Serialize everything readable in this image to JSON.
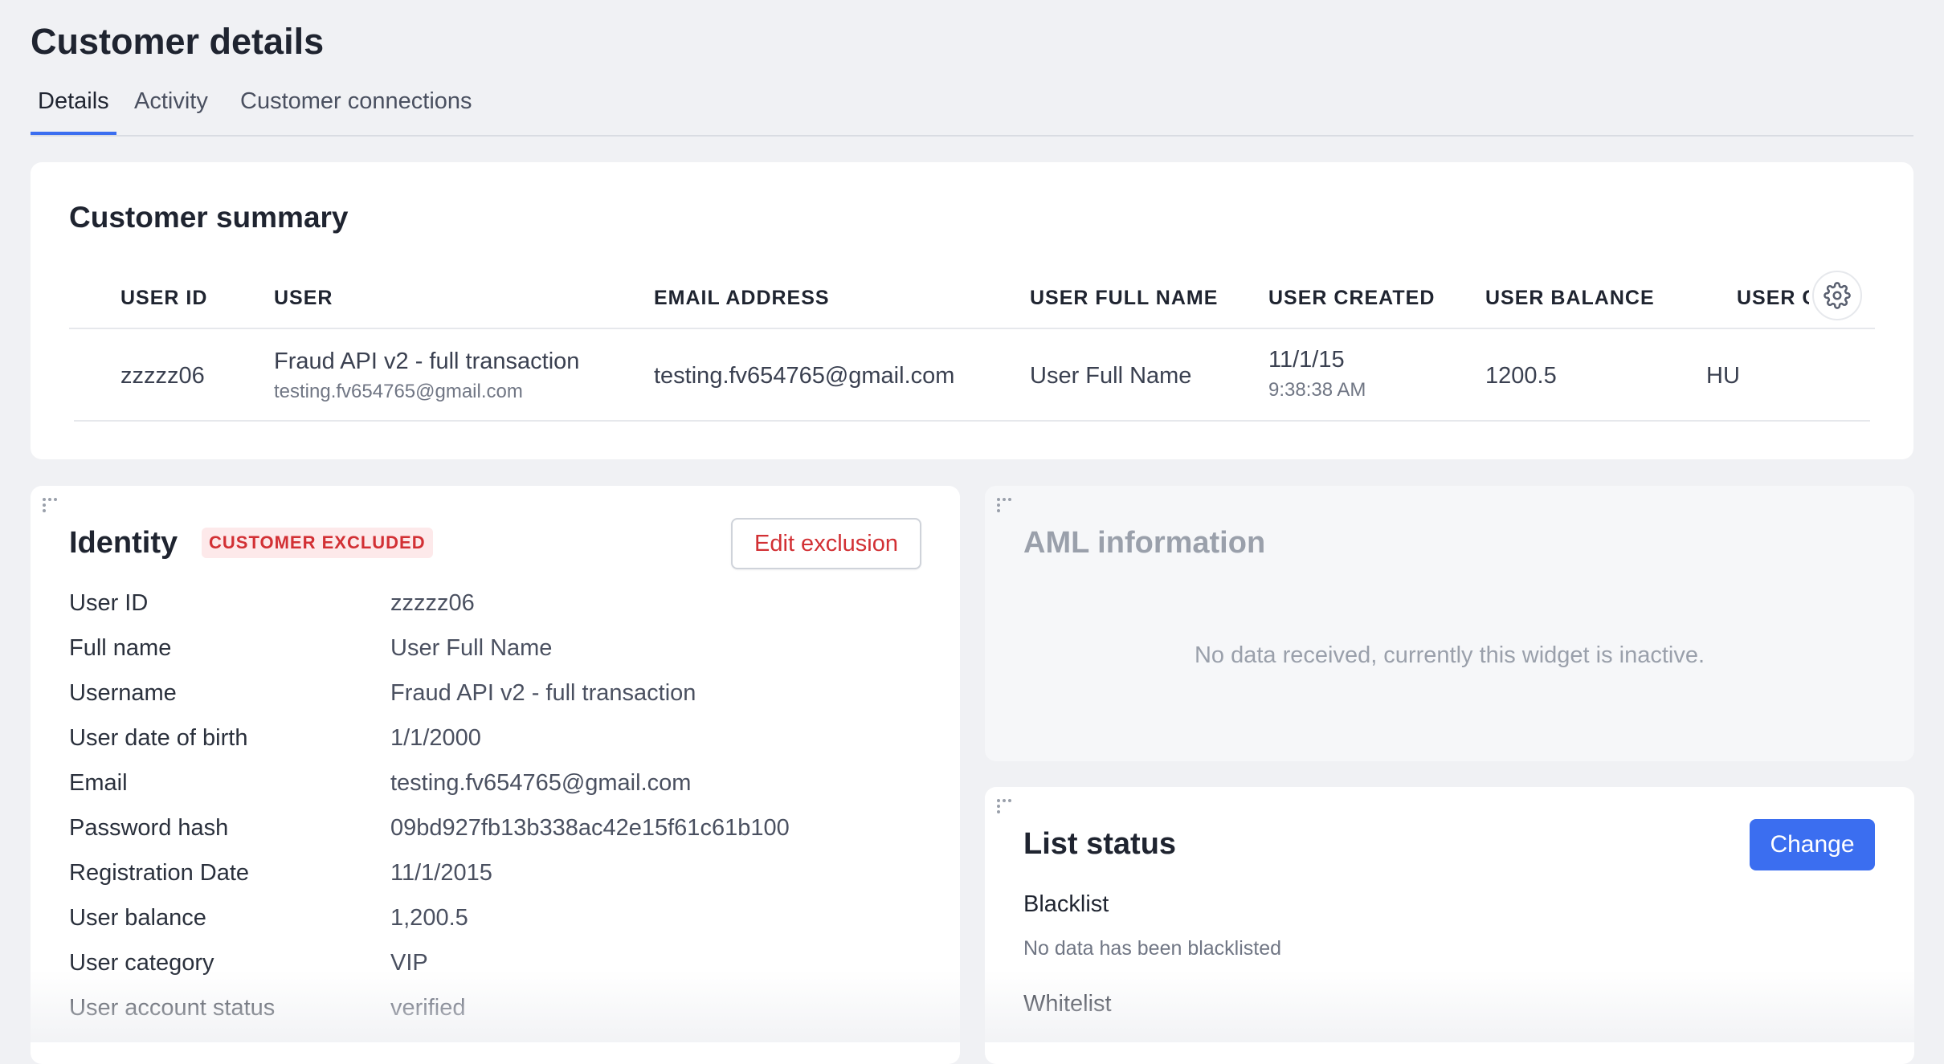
{
  "page": {
    "title": "Customer details"
  },
  "tabs": [
    {
      "label": "Details",
      "active": true
    },
    {
      "label": "Activity",
      "active": false
    },
    {
      "label": "Customer connections",
      "active": false
    }
  ],
  "summary": {
    "title": "Customer summary",
    "columns": [
      "USER ID",
      "USER",
      "EMAIL ADDRESS",
      "USER FULL NAME",
      "USER CREATED",
      "USER BALANCE",
      "USER COUNTRY"
    ],
    "row": {
      "user_id": "zzzzz06",
      "user_name": "Fraud API v2 - full transaction",
      "user_email_sub": "testing.fv654765@gmail.com",
      "email": "testing.fv654765@gmail.com",
      "full_name": "User Full Name",
      "created_date": "11/1/15",
      "created_time": "9:38:38 AM",
      "balance": "1200.5",
      "country": "HU"
    },
    "settings_icon": "gear-icon"
  },
  "identity": {
    "title": "Identity",
    "badge": "CUSTOMER EXCLUDED",
    "badge_color": "#d23034",
    "edit_button": "Edit exclusion",
    "fields": [
      {
        "label": "User ID",
        "value": "zzzzz06"
      },
      {
        "label": "Full name",
        "value": "User Full Name"
      },
      {
        "label": "Username",
        "value": "Fraud API v2 - full transaction"
      },
      {
        "label": "User date of birth",
        "value": "1/1/2000"
      },
      {
        "label": "Email",
        "value": "testing.fv654765@gmail.com"
      },
      {
        "label": "Password hash",
        "value": "09bd927fb13b338ac42e15f61c61b100"
      },
      {
        "label": "Registration Date",
        "value": "11/1/2015"
      },
      {
        "label": "User balance",
        "value": "1,200.5"
      },
      {
        "label": "User category",
        "value": "VIP"
      },
      {
        "label": "User account status",
        "value": "verified"
      }
    ]
  },
  "aml": {
    "title": "AML information",
    "message": "No data received, currently this widget is inactive."
  },
  "list_status": {
    "title": "List status",
    "change_button": "Change",
    "accent": "#3b6ef0",
    "blacklist_label": "Blacklist",
    "blacklist_value": "No data has been blacklisted",
    "whitelist_label": "Whitelist"
  },
  "icons": {
    "drag": "drag-handle-icon",
    "settings": "gear-icon"
  }
}
